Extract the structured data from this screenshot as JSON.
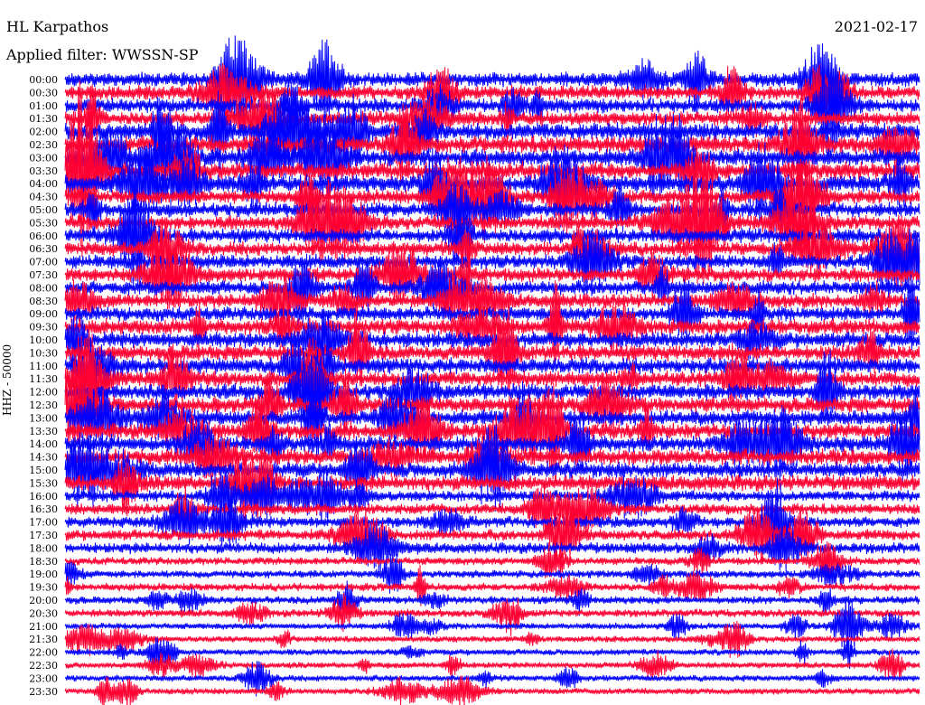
{
  "header": {
    "station": "HL Karpathos",
    "filter": "Applied filter: WWSSN-SP",
    "date": "2021-02-17"
  },
  "axis": {
    "ylabel": "HHZ - 50000"
  },
  "colors": {
    "trace_odd": "#0000ff",
    "trace_even": "#ff0033",
    "background": "#ffffff"
  },
  "chart_data": {
    "type": "line",
    "title": "HL Karpathos",
    "ylabel": "HHZ - 50000",
    "categories": [
      "00:00",
      "00:30",
      "01:00",
      "01:30",
      "02:00",
      "02:30",
      "03:00",
      "03:30",
      "04:00",
      "04:30",
      "05:00",
      "05:30",
      "06:00",
      "06:30",
      "07:00",
      "07:30",
      "08:00",
      "08:30",
      "09:00",
      "09:30",
      "10:00",
      "10:30",
      "11:00",
      "11:30",
      "12:00",
      "12:30",
      "13:00",
      "13:30",
      "14:00",
      "14:30",
      "15:00",
      "15:30",
      "16:00",
      "16:30",
      "17:00",
      "17:30",
      "18:00",
      "18:30",
      "19:00",
      "19:30",
      "20:00",
      "20:30",
      "21:00",
      "21:30",
      "22:00",
      "22:30",
      "23:00",
      "23:30"
    ],
    "series": [
      {
        "name": "blue",
        "values_note": "rows at even index"
      },
      {
        "name": "red",
        "values_note": "rows at odd index"
      }
    ],
    "grid": false,
    "legend": "none",
    "annotations": []
  }
}
